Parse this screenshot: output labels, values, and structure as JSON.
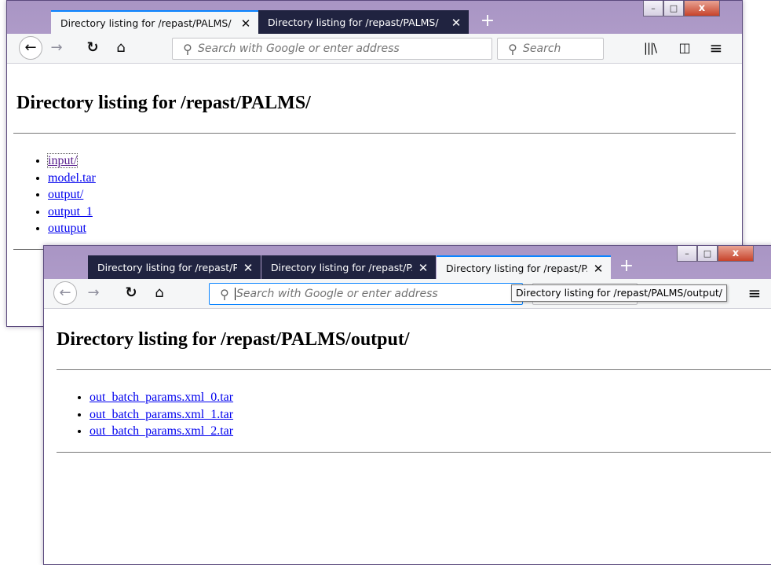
{
  "back_window": {
    "tabs": [
      {
        "title": "Directory listing for /repast/PALMS/",
        "active": true
      },
      {
        "title": "Directory listing for /repast/PALMS/",
        "active": false
      }
    ],
    "new_tab": "+",
    "controls": {
      "minimize": "–",
      "maximize": "□",
      "close": "x"
    },
    "url_placeholder": "Search with Google or enter address",
    "search_placeholder": "Search",
    "icons": [
      "back-icon",
      "forward-icon",
      "reload-icon",
      "home-icon",
      "search-icon",
      "library-icon",
      "sidebar-icon",
      "menu-icon"
    ],
    "page": {
      "heading": "Directory listing for /repast/PALMS/",
      "items": [
        "input/",
        "model.tar",
        "output/",
        "output_1",
        "outuput"
      ]
    }
  },
  "front_window": {
    "tabs": [
      {
        "title": "Directory listing for /repast/PALMS/",
        "active": false
      },
      {
        "title": "Directory listing for /repast/PALMS/",
        "active": false
      },
      {
        "title": "Directory listing for /repast/PALMS/output/",
        "active": true
      }
    ],
    "new_tab": "+",
    "controls": {
      "minimize": "–",
      "maximize": "□",
      "close": "x"
    },
    "url_placeholder": "Search with Google or enter address",
    "tooltip": "Directory listing for /repast/PALMS/output/",
    "page": {
      "heading": "Directory listing for /repast/PALMS/output/",
      "items": [
        "out_batch_params.xml_0.tar",
        "out_batch_params.xml_1.tar",
        "out_batch_params.xml_2.tar"
      ]
    }
  },
  "colors": {
    "accent": "#0a84ff",
    "tab_inactive": "#202340",
    "link": "#0000ee",
    "link_visited": "#551a8b"
  }
}
